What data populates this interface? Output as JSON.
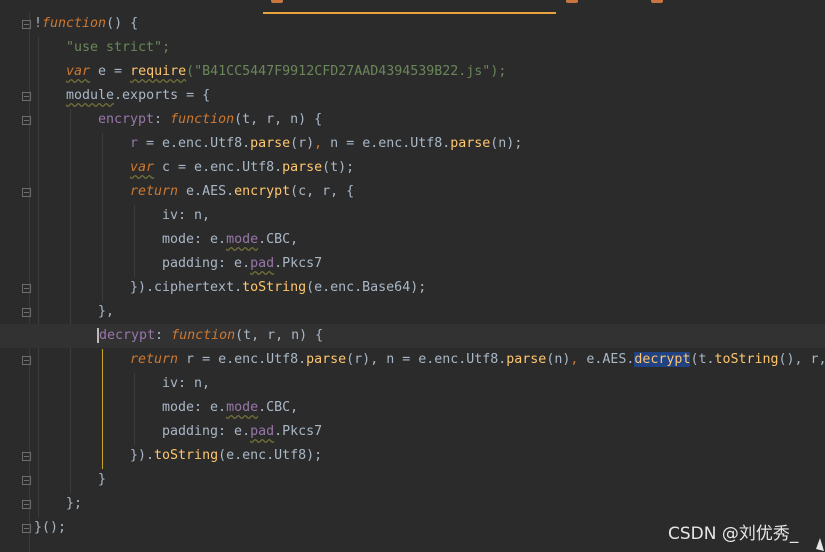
{
  "editor": {
    "tab_active": "",
    "lines": [
      [
        "!",
        "function",
        "() {"
      ],
      [
        "\"use strict\";"
      ],
      [
        "var",
        " e = ",
        "require",
        "(\"B41CC5447F9912CFD27AAD4394539B22.js\");"
      ],
      [
        "module",
        ".exports = {"
      ],
      [
        "encrypt",
        ": ",
        "function",
        "(t, r, n) {"
      ],
      [
        "r",
        " = e.enc.Utf8.",
        "parse",
        "(r)",
        ",",
        " n = e.enc.Utf8.",
        "parse",
        "(n);"
      ],
      [
        "var",
        " c = e.enc.Utf8.",
        "parse",
        "(t);"
      ],
      [
        "return",
        " e.AES.",
        "encrypt",
        "(c, r, {"
      ],
      [
        "iv",
        ": n,"
      ],
      [
        "mode",
        ": e.",
        "mode",
        ".CBC,"
      ],
      [
        "padding",
        ": e.",
        "pad",
        ".Pkcs7"
      ],
      [
        "}).ciphertext.",
        "toString",
        "(e.enc.Base64);"
      ],
      [
        "},"
      ],
      [
        "decrypt",
        ": ",
        "function",
        "(t, r, n) {"
      ],
      [
        "return",
        " r = e.enc.Utf8.",
        "parse",
        "(r), n = e.enc.Utf8.",
        "parse",
        "(n)",
        ",",
        " e.AES.",
        "decrypt",
        "(t.",
        "toString",
        "(), r,"
      ],
      [
        "iv",
        ": n,"
      ],
      [
        "mode",
        ": e.",
        "mode",
        ".CBC,"
      ],
      [
        "padding",
        ": e.",
        "pad",
        ".Pkcs7"
      ],
      [
        "}).",
        "toString",
        "(e.enc.Utf8);"
      ],
      [
        "}"
      ],
      [
        "};"
      ],
      [
        "}();"
      ]
    ]
  },
  "watermark": "CSDN @刘优秀_",
  "colors": {
    "background": "#2b2b2b",
    "keyword": "#cc7832",
    "string": "#6a8759",
    "property": "#9876aa",
    "function_name": "#ffc66d",
    "method": "#6897bb",
    "identifier": "#a9b7c6"
  }
}
